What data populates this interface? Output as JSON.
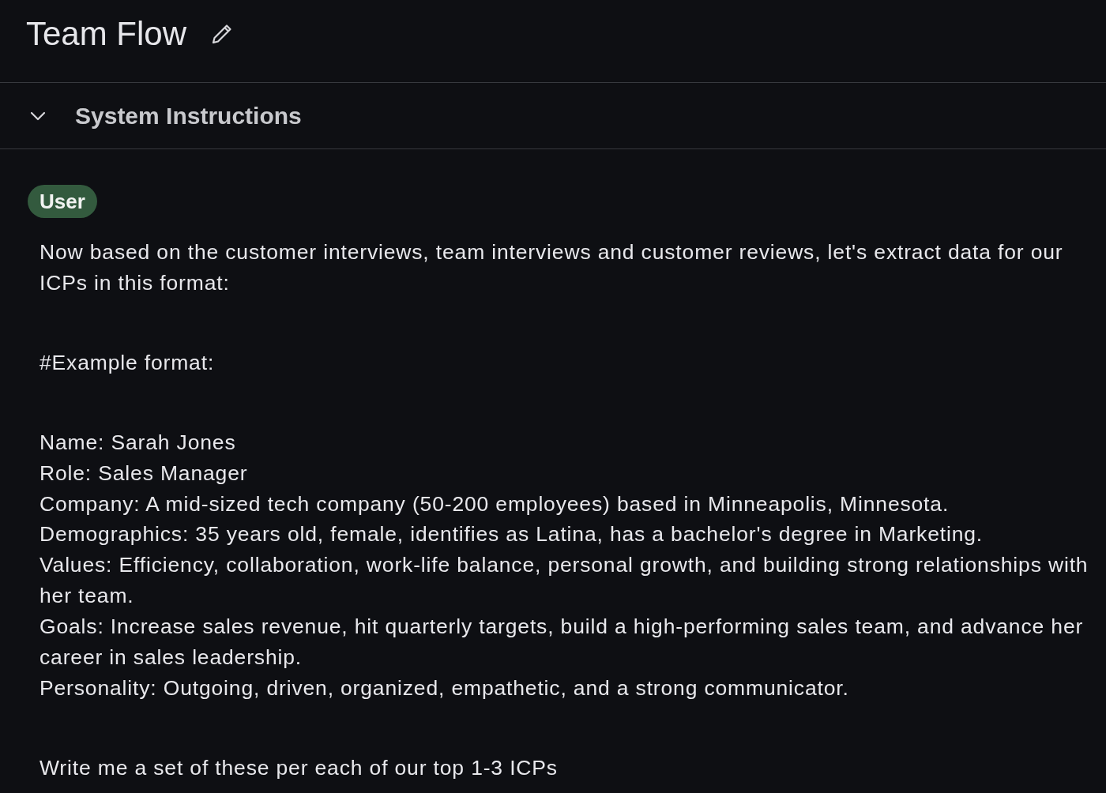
{
  "header": {
    "title": "Team Flow"
  },
  "section": {
    "title": "System Instructions",
    "expanded": true
  },
  "message": {
    "role": "User",
    "blocks": [
      {
        "lines": [
          "Now based on the customer interviews, team interviews and customer reviews, let's extract data for our ICPs in this format:"
        ]
      },
      {
        "lines": [
          "#Example format:"
        ]
      },
      {
        "lines": [
          "Name: Sarah Jones",
          "Role: Sales Manager",
          "Company: A mid-sized tech company (50-200 employees) based in Minneapolis, Minnesota.",
          "Demographics: 35 years old, female, identifies as Latina, has a bachelor's degree in Marketing.",
          "Values: Efficiency, collaboration, work-life balance, personal growth, and building strong relationships with her team.",
          "Goals: Increase sales revenue, hit quarterly targets, build a high-performing sales team, and advance her career in sales leadership.",
          "Personality: Outgoing, driven, organized, empathetic, and a strong communicator."
        ]
      },
      {
        "lines": [
          "Write me a set of these per each of our top 1-3 ICPs"
        ]
      }
    ]
  }
}
